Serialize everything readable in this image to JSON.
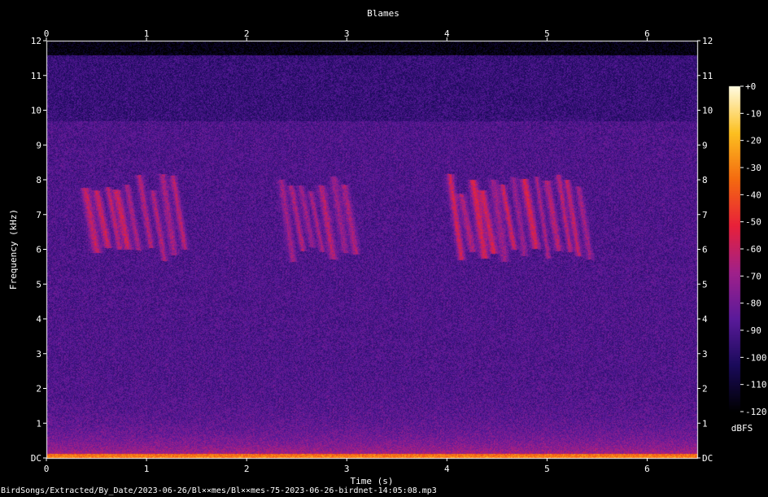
{
  "chart_data": {
    "type": "heatmap",
    "title": "Blames",
    "xlabel": "Time (s)",
    "ylabel": "Frequency (kHz)",
    "xlim": [
      0,
      6.5
    ],
    "ylim": [
      0,
      12
    ],
    "x_ticks": [
      "0",
      "1",
      "2",
      "3",
      "4",
      "5",
      "6"
    ],
    "y_ticks": [
      "DC",
      "1",
      "2",
      "3",
      "4",
      "5",
      "6",
      "7",
      "8",
      "9",
      "10",
      "11",
      "12"
    ],
    "colorbar": {
      "label": "dBFS",
      "ticks": [
        "+0",
        "-10",
        "-20",
        "-30",
        "-40",
        "-50",
        "-60",
        "-70",
        "-80",
        "-90",
        "-100",
        "-110",
        "-120"
      ],
      "range": [
        -120,
        0
      ],
      "colors": [
        "#000000",
        "#1a0a5a",
        "#5a1a9a",
        "#a0208a",
        "#e8203a",
        "#f46a10",
        "#fcc020",
        "#fffbe0"
      ]
    },
    "call_bursts_s": [
      [
        0.35,
        1.35
      ],
      [
        2.3,
        3.05
      ],
      [
        4.0,
        5.4
      ]
    ]
  },
  "footer": "BirdSongs/Extracted/By_Date/2023-06-26/Bl××mes/Bl××mes-75-2023-06-26-birdnet-14:05:08.mp3"
}
